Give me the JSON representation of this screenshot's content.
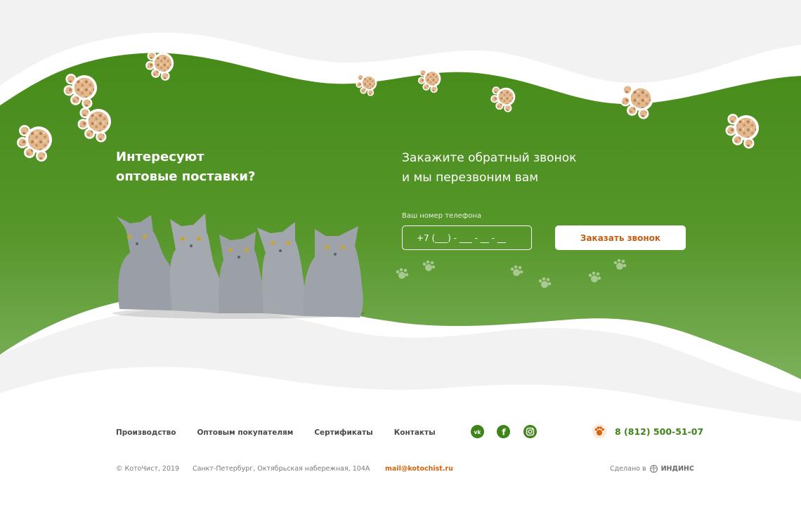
{
  "promo": {
    "headline_line1": "Интересуют",
    "headline_line2": "оптовые поставки?",
    "callout_line1": "Закажите обратный звонок",
    "callout_line2": "и мы перезвоним вам"
  },
  "form": {
    "phone_label": "Ваш номер телефона",
    "phone_placeholder": "+7 (___) - ___ - __ - __",
    "submit_label": "Заказать звонок"
  },
  "footer": {
    "nav": [
      "Производство",
      "Оптовым покупателям",
      "Сертификаты",
      "Контакты"
    ],
    "social": [
      "vk-icon",
      "facebook-icon",
      "instagram-icon"
    ],
    "phone": "8 (812) 500-51-07",
    "copyright": "© КотоЧист, 2019",
    "address": "Санкт-Петербург, Октябрьская набережная, 104А",
    "email": "mail@kotochist.ru",
    "made_by_label": "Сделано в",
    "studio": "ИНДИНС"
  },
  "colors": {
    "brand_green": "#3f8419",
    "accent_orange": "#d4630f",
    "footer_bg": "#ffffff",
    "page_bg": "#f2f2f2"
  }
}
